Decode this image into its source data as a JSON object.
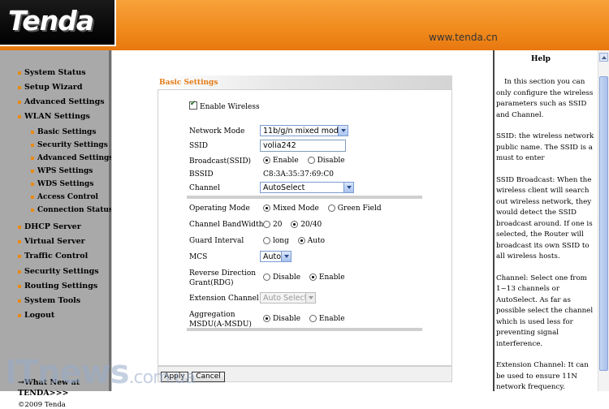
{
  "brand": {
    "logo": "Tenda",
    "url": "www.tenda.cn"
  },
  "nav": {
    "items": [
      {
        "label": "System Status",
        "sub": false
      },
      {
        "label": "Setup Wizard",
        "sub": false
      },
      {
        "label": "Advanced Settings",
        "sub": false
      },
      {
        "label": "WLAN Settings",
        "sub": false
      },
      {
        "label": "Basic Settings",
        "sub": true
      },
      {
        "label": "Security Settings",
        "sub": true
      },
      {
        "label": "Advanced Settings",
        "sub": true
      },
      {
        "label": "WPS Settings",
        "sub": true
      },
      {
        "label": "WDS Settings",
        "sub": true
      },
      {
        "label": "Access Control",
        "sub": true
      },
      {
        "label": "Connection Status",
        "sub": true
      },
      {
        "label": "DHCP Server",
        "sub": false
      },
      {
        "label": "Virtual Server",
        "sub": false
      },
      {
        "label": "Traffic Control",
        "sub": false
      },
      {
        "label": "Security Settings",
        "sub": false
      },
      {
        "label": "Routing Settings",
        "sub": false
      },
      {
        "label": "System Tools",
        "sub": false
      },
      {
        "label": "Logout",
        "sub": false
      }
    ],
    "whats_new_line1": "→What New at",
    "whats_new_line2": "TENDA>>>",
    "copyright": "©2009 Tenda"
  },
  "main": {
    "section_title": "Basic Settings",
    "enable_wireless": "Enable Wireless",
    "network_mode_label": "Network Mode",
    "network_mode_value": "11b/g/n mixed mode",
    "ssid_label": "SSID",
    "ssid_value": "volia242",
    "broadcast_label": "Broadcast(SSID)",
    "broadcast_enable": "Enable",
    "broadcast_disable": "Disable",
    "bssid_label": "BSSID",
    "bssid_value": "C8:3A:35:37:69:C0",
    "channel_label": "Channel",
    "channel_value": "AutoSelect",
    "operating_mode_label": "Operating Mode",
    "operating_mixed": "Mixed Mode",
    "operating_green": "Green Field",
    "bandwidth_label": "Channel BandWidth",
    "bandwidth_20": "20",
    "bandwidth_2040": "20/40",
    "guard_label": "Guard Interval",
    "guard_long": "long",
    "guard_auto": "Auto",
    "mcs_label": "MCS",
    "mcs_value": "Auto",
    "rdg_label_1": "Reverse Direction",
    "rdg_label_2": "Grant(RDG)",
    "rdg_disable": "Disable",
    "rdg_enable": "Enable",
    "ext_channel_label": "Extension Channel",
    "ext_channel_value": "Auto Select",
    "amsdu_label_1": "Aggregation",
    "amsdu_label_2": "MSDU(A-MSDU)",
    "amsdu_disable": "Disable",
    "amsdu_enable": "Enable",
    "apply": "Apply",
    "cancel": "Cancel"
  },
  "help": {
    "title": "Help",
    "paragraphs": [
      "In this section you can only configure the wireless parameters such as SSID and Channel.",
      "SSID: the wireless network public name. The SSID is a must to enter",
      "SSID Broadcast: When the wireless client will search out wireless network, they would detect the SSID broadcast around. If one is selected, the Router will broadcast its own SSID to all wireless hosts.",
      "Channel: Select one from 1~13 channels or AutoSelect. As far as possible select the channel which is used less for preventing signal interference.",
      "Extension Channel: It can be used to ensure 11N network frequency."
    ]
  },
  "watermark": {
    "main": "ITnews",
    "suffix": ".com.ua"
  },
  "colors": {
    "header_orange": "#f08a1c",
    "accent": "#e57b14",
    "nav_bg": "#a9a9a9"
  }
}
